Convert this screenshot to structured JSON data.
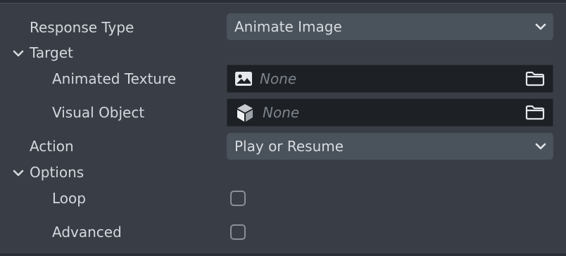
{
  "properties": {
    "response_type": {
      "label": "Response Type",
      "value": "Animate Image"
    },
    "target": {
      "label": "Target",
      "expanded": true,
      "animated_texture": {
        "label": "Animated Texture",
        "value": "None",
        "icon": "image-icon"
      },
      "visual_object": {
        "label": "Visual Object",
        "value": "None",
        "icon": "cube-icon"
      }
    },
    "action": {
      "label": "Action",
      "value": "Play or Resume"
    },
    "options": {
      "label": "Options",
      "expanded": true,
      "loop": {
        "label": "Loop",
        "checked": false
      },
      "advanced": {
        "label": "Advanced",
        "checked": false
      }
    }
  },
  "colors": {
    "panel_bg": "#393e46",
    "dropdown_bg": "#4a525b",
    "field_bg": "#1d2126",
    "text": "#d4d7dc",
    "placeholder": "#7d838b"
  }
}
